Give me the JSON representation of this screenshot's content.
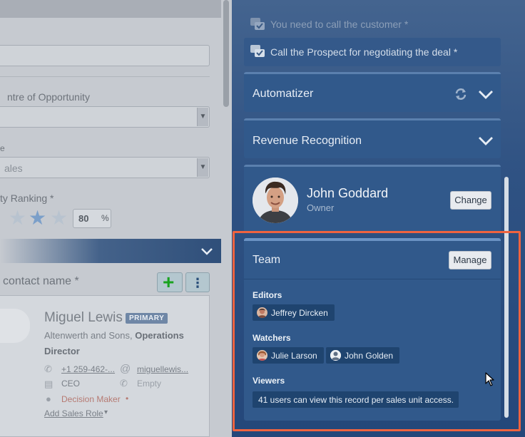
{
  "left": {
    "opportunity_label": "ntre of Opportunity",
    "sales_label": "e",
    "sales_value": "ales",
    "ranking_label": "ty Ranking *",
    "ranking_percent": "80",
    "percent_symbol": "%",
    "contact_label": "contact name *",
    "add_symbol": "+",
    "more_symbol": "⋮",
    "contact": {
      "name": "Miguel Lewis",
      "badge": "PRIMARY",
      "company": "Altenwerth and Sons, ",
      "company_bold": "Operations",
      "title_line": "Director",
      "phone": "+1 259-462-...",
      "email": "miguellewis...",
      "job": "CEO",
      "extension": "Empty",
      "role": "Decision Maker",
      "role_dot": "•",
      "add_role": "Add Sales Role",
      "add_role_caret": "▾"
    }
  },
  "right": {
    "todos": [
      {
        "text": "You need to call the customer *"
      },
      {
        "text": "Call the Prospect for negotiating the deal *"
      }
    ],
    "automatizer": {
      "title": "Automatizer"
    },
    "revenue": {
      "title": "Revenue Recognition"
    },
    "owner": {
      "name": "John Goddard",
      "role": "Owner",
      "change_label": "Change"
    },
    "team": {
      "title": "Team",
      "manage_label": "Manage",
      "editors_label": "Editors",
      "editors": [
        {
          "name": "Jeffrey Dircken"
        }
      ],
      "watchers_label": "Watchers",
      "watchers": [
        {
          "name": "Julie Larson"
        },
        {
          "name": "John Golden"
        }
      ],
      "viewers_label": "Viewers",
      "viewers_text": "41 users can view this record per sales unit access."
    }
  },
  "colors": {
    "panel_bg": "#2f5283",
    "section_bg": "#31598b",
    "chip_bg": "#1f446f",
    "highlight": "#f0633f",
    "add_green": "#19a31f"
  }
}
